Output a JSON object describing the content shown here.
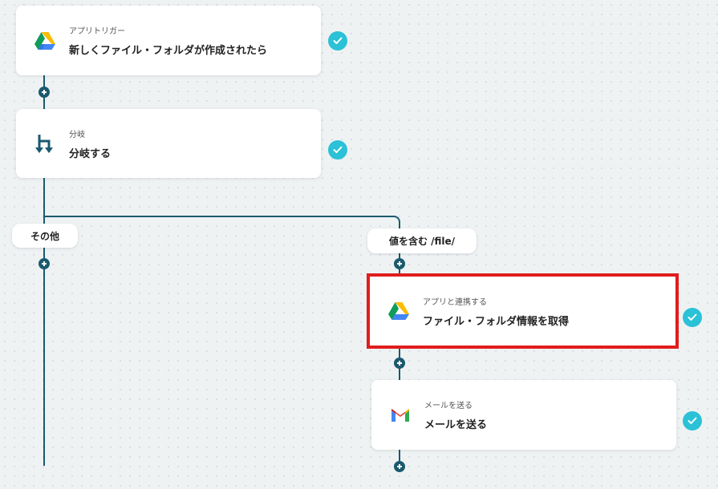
{
  "nodes": [
    {
      "sub": "アプリトリガー",
      "title": "新しくファイル・フォルダが作成されたら",
      "icon": "google-drive-icon"
    },
    {
      "sub": "分岐",
      "title": "分岐する",
      "icon": "branch-icon"
    },
    {
      "sub": "アプリと連携する",
      "title": "ファイル・フォルダ情報を取得",
      "icon": "google-drive-icon"
    },
    {
      "sub": "メールを送る",
      "title": "メールを送る",
      "icon": "gmail-icon"
    }
  ],
  "branches": {
    "left_label": "その他",
    "right_label": "値を含む /file/"
  },
  "colors": {
    "line": "#1b5a6e",
    "check": "#2bc1d6",
    "highlight": "#e11d1d"
  }
}
